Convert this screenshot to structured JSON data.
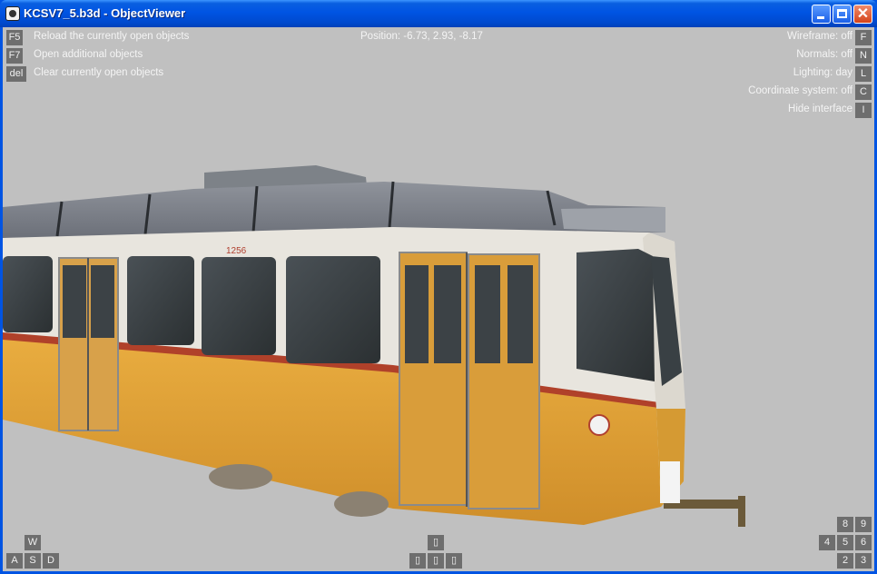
{
  "window": {
    "title": "KCSV7_5.b3d - ObjectViewer",
    "minimize_glyph": "minimize-icon",
    "maximize_glyph": "maximize-icon",
    "close_glyph": "✕"
  },
  "commands": [
    {
      "key": "F5",
      "label": "Reload the currently open objects"
    },
    {
      "key": "F7",
      "label": "Open additional objects"
    },
    {
      "key": "del",
      "label": "Clear currently open objects"
    }
  ],
  "position_readout": "Position: -6.73, 2.93, -8.17",
  "toggles": [
    {
      "label": "Wireframe: off",
      "key": "F"
    },
    {
      "label": "Normals: off",
      "key": "N"
    },
    {
      "label": "Lighting: day",
      "key": "L"
    },
    {
      "label": "Coordinate system: off",
      "key": "C"
    },
    {
      "label": "Hide interface",
      "key": "I"
    }
  ],
  "movement_keys": {
    "up": "W",
    "left": "A",
    "down": "S",
    "right": "D"
  },
  "arrow_keys": {
    "up": "▯",
    "left": "▯",
    "center": "▯",
    "right": "▯"
  },
  "numpad_keys": {
    "k8": "8",
    "k9": "9",
    "k4": "4",
    "k5": "5",
    "k6": "6",
    "k2": "2",
    "k3": "3"
  },
  "tram_number": "1256",
  "colors": {
    "viewport_bg": "#c0c0c0",
    "tram_orange": "#e2a63a",
    "tram_white": "#ebe8e2",
    "roof_gray": "#7c8089"
  }
}
